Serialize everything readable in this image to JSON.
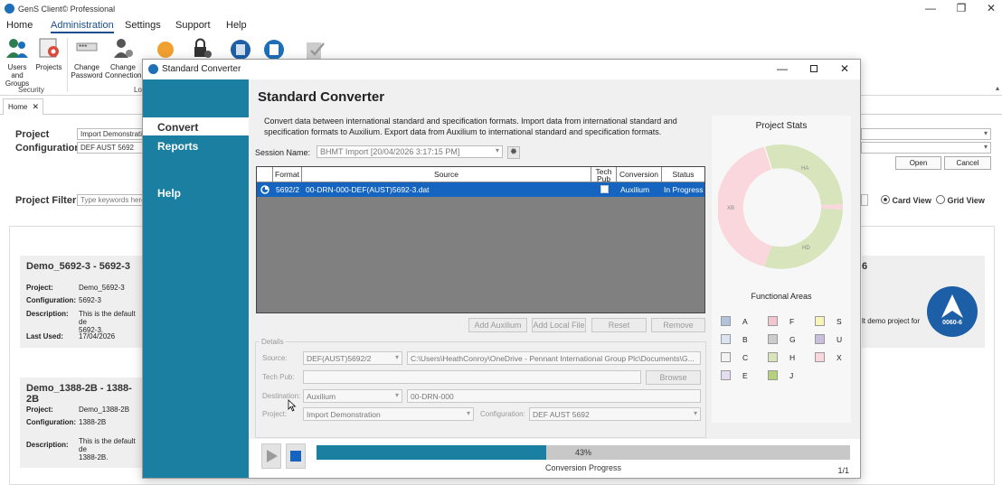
{
  "app": {
    "title": "GenS Client© Professional",
    "window_controls": {
      "minimize": "—",
      "maximize": "❐",
      "close": "✕"
    }
  },
  "menu": [
    "Home",
    "Administration",
    "Settings",
    "Support",
    "Help"
  ],
  "ribbon": {
    "buttons": [
      {
        "label1": "Users and",
        "label2": "Groups",
        "icon": "users-groups-icon"
      },
      {
        "label1": "Projects",
        "label2": "",
        "icon": "projects-icon"
      },
      {
        "label1": "Change",
        "label2": "Password",
        "icon": "password-icon"
      },
      {
        "label1": "Change",
        "label2": "Connection",
        "icon": "connection-icon"
      }
    ],
    "group_security": "Security",
    "group_lo": "Lo"
  },
  "tab": {
    "label": "Home",
    "close": "✕"
  },
  "background": {
    "project_label": "Project",
    "project_value": "Import Demonstration",
    "configuration_label": "Configuration",
    "configuration_value": "DEF AUST 5692",
    "open": "Open",
    "cancel": "Cancel",
    "project_filter_label": "Project Filter",
    "filter_placeholder": "Type keywords here",
    "card_view": "Card View",
    "grid_view": "Grid View",
    "cards": [
      {
        "title": "Demo_5692-3 - 5692-3",
        "project_label": "Project:",
        "project": "Demo_5692-3",
        "configuration_label": "Configuration:",
        "configuration": "5692-3",
        "description_label": "Description:",
        "description1": "This is the default de",
        "description2": "5692-3.",
        "last_used_label": "Last Used:",
        "last_used": "17/04/2026"
      },
      {
        "title": "Demo_1388-2B - 1388-2B",
        "project_label": "Project:",
        "project": "Demo_1388-2B",
        "configuration_label": "Configuration:",
        "configuration": "1388-2B",
        "description_label": "Description:",
        "description1": "This is the default de",
        "description2": "1388-2B."
      }
    ],
    "right_card_title": "6",
    "right_card_desc": "lt demo project for",
    "badge_label": "0060-6"
  },
  "dialog": {
    "title": "Standard Converter",
    "nav": [
      "Convert",
      "Reports",
      "Help"
    ],
    "heading": "Standard Converter",
    "description": "Convert data between international standard and specification formats. Import data from international standard and specification formats to Auxilium. Export data from Auxilium to international standard and specification formats.",
    "session_label": "Session Name:",
    "session_value": "BHMT Import [20/04/2026 3:17:15 PM]",
    "grid": {
      "headers": [
        "Format",
        "Source",
        "Tech Pub",
        "Conversion",
        "Status"
      ],
      "rows": [
        {
          "format": "5692/2",
          "source": "00-DRN-000-DEF(AUST)5692-3.dat",
          "conversion": "Auxilium",
          "status": "In Progress"
        }
      ]
    },
    "buttons": {
      "add_auxilium": "Add Auxilium",
      "add_local_file": "Add Local File",
      "reset": "Reset",
      "remove": "Remove",
      "browse": "Browse"
    },
    "details": {
      "legend": "Details",
      "source_label": "Source:",
      "source_format": "DEF(AUST)5692/2",
      "source_path": "C:\\Users\\HeathConroy\\OneDrive - Pennant International Group Plc\\Documents\\G...",
      "techpub_label": "Tech Pub:",
      "destination_label": "Destination:",
      "destination_value": "Auxilium",
      "destination_name": "00-DRN-000",
      "project_label": "Project:",
      "project_value": "Import Demonstration",
      "configuration_label": "Configuration:",
      "configuration_value": "DEF AUST 5692"
    },
    "stats": {
      "title": "Project Stats",
      "functional_areas": "Functional Areas",
      "donut_labels": [
        "HA",
        "XB",
        "HD"
      ],
      "legend": [
        {
          "label": "A",
          "color": "#b3c3dc"
        },
        {
          "label": "B",
          "color": "#dbe5f1"
        },
        {
          "label": "C",
          "color": "#f2f2f2"
        },
        {
          "label": "E",
          "color": "#e4dcef"
        },
        {
          "label": "F",
          "color": "#f2c6cf"
        },
        {
          "label": "G",
          "color": "#cccccc"
        },
        {
          "label": "H",
          "color": "#d8e4bc"
        },
        {
          "label": "J",
          "color": "#b5d17a"
        },
        {
          "label": "S",
          "color": "#f7f6b8"
        },
        {
          "label": "U",
          "color": "#c9bfdd"
        },
        {
          "label": "X",
          "color": "#fad7dd"
        }
      ]
    },
    "progress": {
      "percent": 43,
      "percent_label": "43%",
      "label": "Conversion Progress",
      "count": "1/1"
    }
  }
}
